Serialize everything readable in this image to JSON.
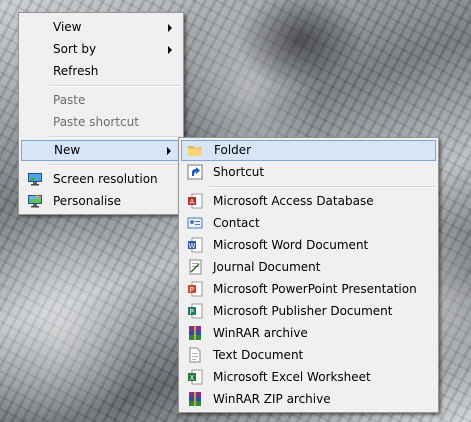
{
  "context_menu": {
    "items": [
      {
        "label": "View",
        "has_submenu": true
      },
      {
        "label": "Sort by",
        "has_submenu": true
      },
      {
        "label": "Refresh"
      },
      {
        "label": "Paste",
        "disabled": true
      },
      {
        "label": "Paste shortcut",
        "disabled": true
      },
      {
        "label": "New",
        "has_submenu": true,
        "highlighted": true
      },
      {
        "label": "Screen resolution",
        "icon": "monitor-icon"
      },
      {
        "label": "Personalise",
        "icon": "personalise-icon"
      }
    ]
  },
  "new_submenu": {
    "items": [
      {
        "label": "Folder",
        "icon": "folder-icon",
        "highlighted": true
      },
      {
        "label": "Shortcut",
        "icon": "shortcut-icon"
      },
      {
        "label": "Microsoft Access Database",
        "icon": "access-icon"
      },
      {
        "label": "Contact",
        "icon": "contact-icon"
      },
      {
        "label": "Microsoft Word Document",
        "icon": "word-icon"
      },
      {
        "label": "Journal Document",
        "icon": "journal-icon"
      },
      {
        "label": "Microsoft PowerPoint Presentation",
        "icon": "powerpoint-icon"
      },
      {
        "label": "Microsoft Publisher Document",
        "icon": "publisher-icon"
      },
      {
        "label": "WinRAR archive",
        "icon": "winrar-icon"
      },
      {
        "label": "Text Document",
        "icon": "text-document-icon"
      },
      {
        "label": "Microsoft Excel Worksheet",
        "icon": "excel-icon"
      },
      {
        "label": "WinRAR ZIP archive",
        "icon": "winrar-zip-icon"
      }
    ]
  },
  "colors": {
    "menu_bg": "#f0f0f0",
    "highlight_bg": "#d7e6f6",
    "highlight_border": "#79a7db",
    "disabled_text": "#6d6d6d"
  }
}
